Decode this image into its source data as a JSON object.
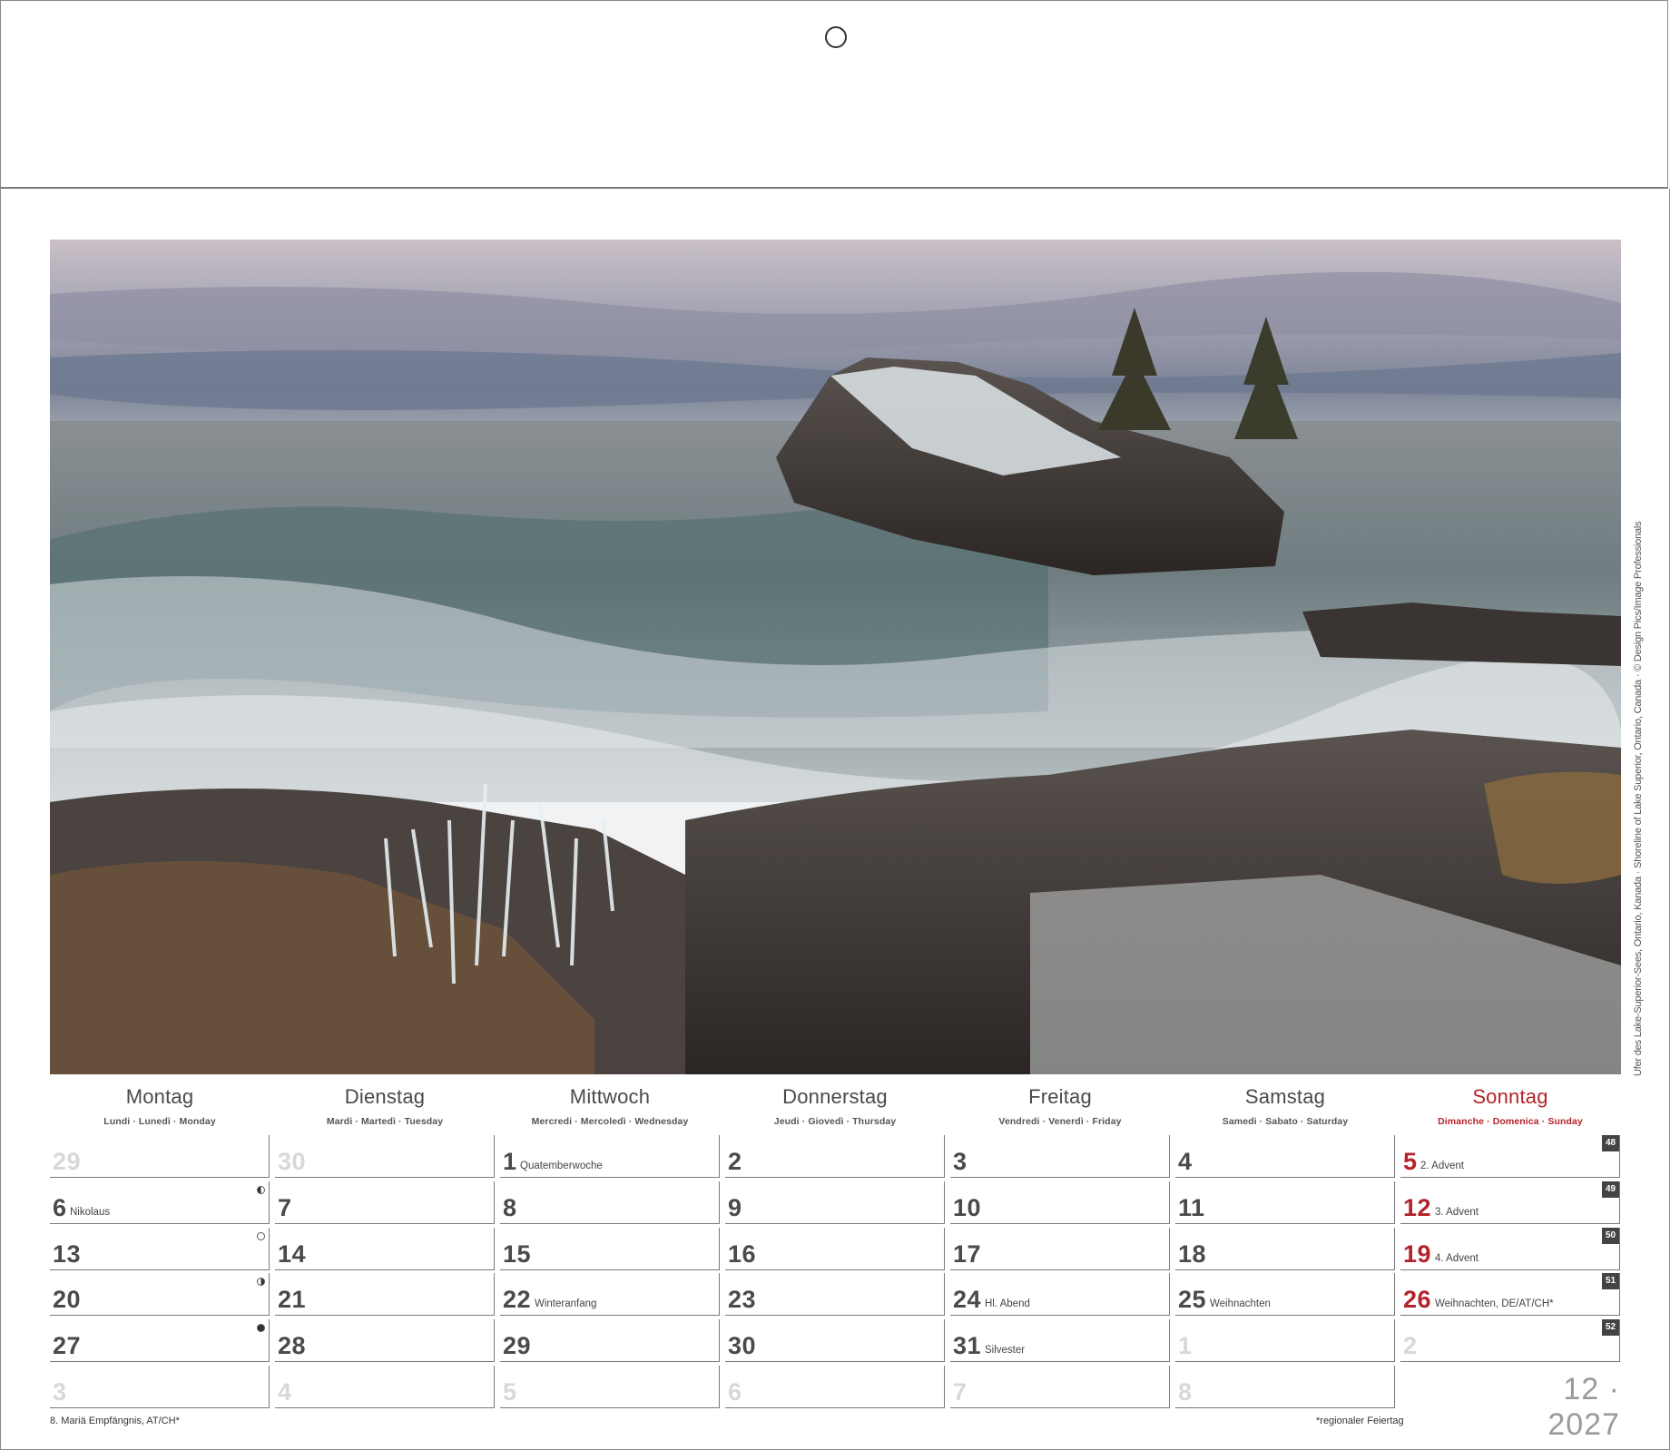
{
  "photo": {
    "credit": "Ufer des Lake-Superior-Sees, Ontario, Kanada · Shoreline of Lake Superior, Ontario, Canada · © Design Pics/Image Professionals"
  },
  "weekdays": [
    {
      "name": "Montag",
      "sub": "Lundi · Lunedì · Monday"
    },
    {
      "name": "Dienstag",
      "sub": "Mardi · Martedì · Tuesday"
    },
    {
      "name": "Mittwoch",
      "sub": "Mercredi · Mercoledì · Wednesday"
    },
    {
      "name": "Donnerstag",
      "sub": "Jeudi · Giovedì · Thursday"
    },
    {
      "name": "Freitag",
      "sub": "Vendredi · Venerdì · Friday"
    },
    {
      "name": "Samstag",
      "sub": "Samedi · Sabato · Saturday"
    },
    {
      "name": "Sonntag",
      "sub": "Dimanche · Domenica · Sunday"
    }
  ],
  "weeks": [
    {
      "week_number": "48",
      "days": [
        {
          "day": "29",
          "faded": true
        },
        {
          "day": "30",
          "faded": true
        },
        {
          "day": "1",
          "note": "Quatemberwoche"
        },
        {
          "day": "2"
        },
        {
          "day": "3"
        },
        {
          "day": "4"
        },
        {
          "day": "5",
          "note": "2. Advent",
          "red": true
        }
      ]
    },
    {
      "week_number": "49",
      "days": [
        {
          "day": "6",
          "note": "Nikolaus",
          "moon": "last"
        },
        {
          "day": "7"
        },
        {
          "day": "8"
        },
        {
          "day": "9"
        },
        {
          "day": "10"
        },
        {
          "day": "11"
        },
        {
          "day": "12",
          "note": "3. Advent",
          "red": true
        }
      ]
    },
    {
      "week_number": "50",
      "days": [
        {
          "day": "13",
          "moon": "full"
        },
        {
          "day": "14"
        },
        {
          "day": "15"
        },
        {
          "day": "16"
        },
        {
          "day": "17"
        },
        {
          "day": "18"
        },
        {
          "day": "19",
          "note": "4. Advent",
          "red": true
        }
      ]
    },
    {
      "week_number": "51",
      "days": [
        {
          "day": "20",
          "moon": "first"
        },
        {
          "day": "21"
        },
        {
          "day": "22",
          "note": "Winteranfang"
        },
        {
          "day": "23"
        },
        {
          "day": "24",
          "note": "Hl. Abend"
        },
        {
          "day": "25",
          "note": "Weihnachten"
        },
        {
          "day": "26",
          "note": "Weihnachten, DE/AT/CH*",
          "red": true
        }
      ]
    },
    {
      "week_number": "52",
      "days": [
        {
          "day": "27",
          "moon": "new"
        },
        {
          "day": "28"
        },
        {
          "day": "29"
        },
        {
          "day": "30"
        },
        {
          "day": "31",
          "note": "Silvester"
        },
        {
          "day": "1",
          "faded": true
        },
        {
          "day": "2",
          "faded": true
        }
      ]
    },
    {
      "week_number": "",
      "days": [
        {
          "day": "3",
          "faded": true
        },
        {
          "day": "4",
          "faded": true
        },
        {
          "day": "5",
          "faded": true
        },
        {
          "day": "6",
          "faded": true
        },
        {
          "day": "7",
          "faded": true
        },
        {
          "day": "8",
          "faded": true
        }
      ]
    }
  ],
  "month_label": "12 · 2027",
  "footnote_left": "8. Mariä Empfängnis, AT/CH*",
  "footnote_right": "*regionaler Feiertag",
  "colors": {
    "sunday_red": "#b3232a",
    "week_badge": "#444444",
    "faded_day": "#d8d8d8"
  }
}
